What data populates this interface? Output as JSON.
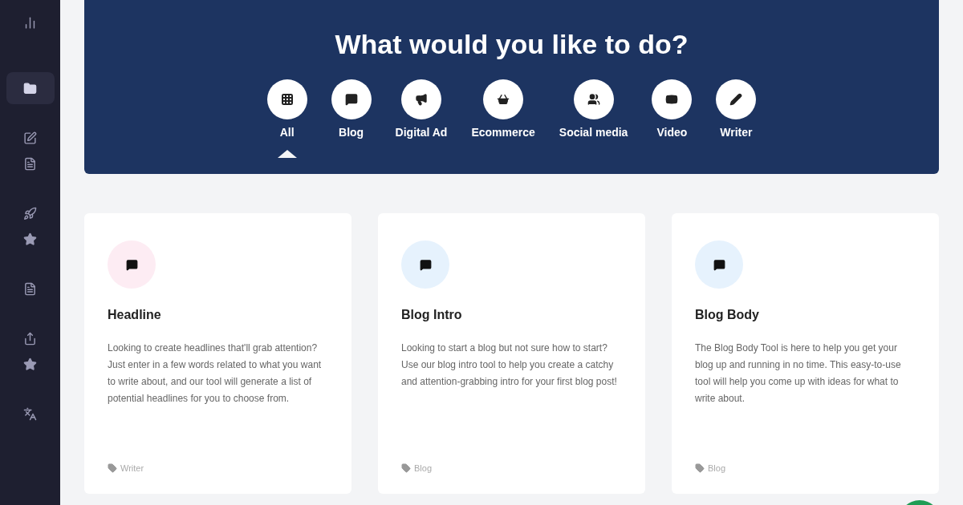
{
  "sidebar": {
    "items": [
      {
        "kind": "chart",
        "selected": false
      },
      {
        "kind": "folder",
        "selected": true
      },
      {
        "kind": "edit",
        "selected": false
      },
      {
        "kind": "file",
        "selected": false
      },
      {
        "kind": "rocket",
        "selected": false
      },
      {
        "kind": "star",
        "selected": false
      },
      {
        "kind": "file",
        "selected": false
      },
      {
        "kind": "share",
        "selected": false
      },
      {
        "kind": "star",
        "selected": false
      },
      {
        "kind": "translate",
        "selected": false
      }
    ]
  },
  "banner": {
    "title": "What would you like to do?",
    "categories": [
      {
        "kind": "grid",
        "label": "All",
        "selected": true
      },
      {
        "kind": "blog",
        "label": "Blog",
        "selected": false
      },
      {
        "kind": "megaphone",
        "label": "Digital Ad",
        "selected": false
      },
      {
        "kind": "basket",
        "label": "Ecommerce",
        "selected": false
      },
      {
        "kind": "users",
        "label": "Social media",
        "selected": false
      },
      {
        "kind": "video",
        "label": "Video",
        "selected": false
      },
      {
        "kind": "pencil",
        "label": "Writer",
        "selected": false
      }
    ]
  },
  "cards": [
    {
      "title": "Headline",
      "color": "#fdecf3",
      "description": "Looking to create headlines that'll grab attention? Just enter in a few words related to what you want to write about, and our tool will generate a list of potential headlines for you to choose from.",
      "tag": "Writer"
    },
    {
      "title": "Blog Intro",
      "color": "#e6f2fd",
      "description": "Looking to start a blog but not sure how to start? Use our blog intro tool to help you create a catchy and attention-grabbing intro for your first blog post!",
      "tag": "Blog"
    },
    {
      "title": "Blog Body",
      "color": "#e6f2fd",
      "description": "The Blog Body Tool is here to help you get your blog up and running in no time. This easy-to-use tool will help you come up with ideas for what to write about.",
      "tag": "Blog"
    }
  ]
}
